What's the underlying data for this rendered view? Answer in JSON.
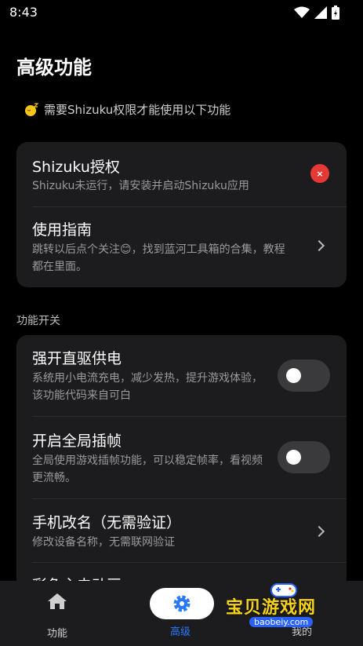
{
  "status_bar": {
    "time": "8:43"
  },
  "header": {
    "title": "高级功能"
  },
  "notice": {
    "text": "需要Shizuku权限才能使用以下功能"
  },
  "card_auth": {
    "shizuku": {
      "title": "Shizuku授权",
      "desc": "Shizuku未运行，请安装并启动Shizuku应用",
      "badge": "×"
    },
    "guide": {
      "title": "使用指南",
      "desc": "跳转以后点个关注😊，找到蓝河工具箱的合集，教程都在里面。"
    }
  },
  "section": {
    "label": "功能开关"
  },
  "card_switches": {
    "force_charge": {
      "title": "强开直驱供电",
      "desc": "系统用小电流充电，减少发热，提升游戏体验，该功能代码来自可白",
      "enabled": false
    },
    "frame_interp": {
      "title": "开启全局插帧",
      "desc": "全局使用游戏插帧功能，可以稳定帧率，看视频更流畅。",
      "enabled": false
    },
    "rename": {
      "title": "手机改名（无需验证）",
      "desc": "修改设备名称，无需联网验证"
    },
    "partial": {
      "title": "彩色主电动画"
    }
  },
  "bottom_nav": {
    "items": [
      {
        "label": "功能",
        "icon": "home-icon"
      },
      {
        "label": "高级",
        "icon": "gear-icon",
        "active": true
      },
      {
        "label": "我的",
        "icon": "person-icon"
      }
    ],
    "active_color": "#2979ff"
  },
  "watermark": {
    "text": "宝贝游戏网",
    "url": "baobeiy.com"
  }
}
